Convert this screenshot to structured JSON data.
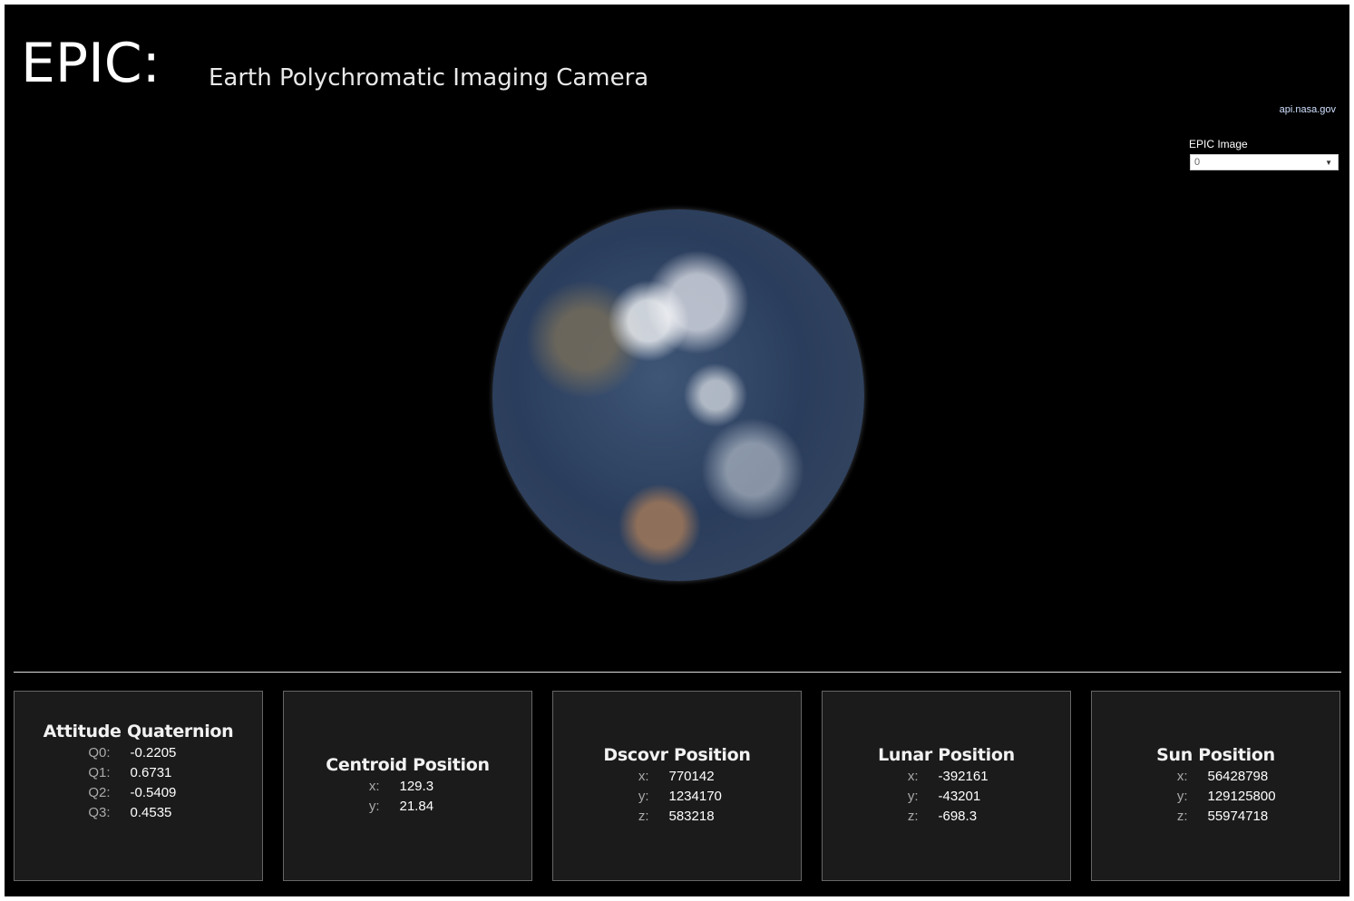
{
  "header": {
    "title": "EPIC:",
    "subtitle": "Earth Polychromatic Imaging Camera",
    "link": "api.nasa.gov"
  },
  "selector": {
    "label": "EPIC Image",
    "value": "0"
  },
  "cards": [
    {
      "title": "Attitude Quaternion",
      "rows": [
        {
          "k": "Q0:",
          "v": "-0.2205"
        },
        {
          "k": "Q1:",
          "v": "0.6731"
        },
        {
          "k": "Q2:",
          "v": "-0.5409"
        },
        {
          "k": "Q3:",
          "v": "0.4535"
        }
      ]
    },
    {
      "title": "Centroid Position",
      "rows": [
        {
          "k": "x:",
          "v": "129.3"
        },
        {
          "k": "y:",
          "v": "21.84"
        }
      ]
    },
    {
      "title": "Dscovr Position",
      "rows": [
        {
          "k": "x:",
          "v": "770142"
        },
        {
          "k": "y:",
          "v": "1234170"
        },
        {
          "k": "z:",
          "v": "583218"
        }
      ]
    },
    {
      "title": "Lunar Position",
      "rows": [
        {
          "k": "x:",
          "v": "-392161"
        },
        {
          "k": "y:",
          "v": "-43201"
        },
        {
          "k": "z:",
          "v": "-698.3"
        }
      ]
    },
    {
      "title": "Sun Position",
      "rows": [
        {
          "k": "x:",
          "v": "56428798"
        },
        {
          "k": "y:",
          "v": "129125800"
        },
        {
          "k": "z:",
          "v": "55974718"
        }
      ]
    }
  ]
}
